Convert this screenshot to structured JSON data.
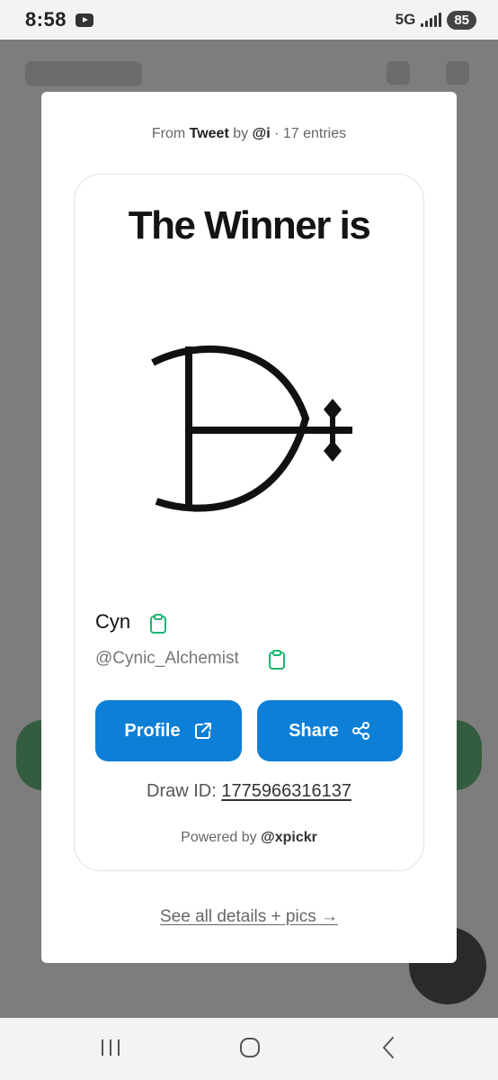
{
  "status_bar": {
    "time": "8:58",
    "network": "5G",
    "battery": "85"
  },
  "modal": {
    "source": {
      "prefix": "From",
      "platform": "Tweet",
      "by_label": "by",
      "author": "@i",
      "entries": "· 17 entries"
    },
    "title": "The Winner is",
    "winner": {
      "name": "Cyn",
      "handle": "@Cynic_Alchemist"
    },
    "buttons": {
      "profile_label": "Profile",
      "share_label": "Share"
    },
    "draw": {
      "label": "Draw ID:",
      "value": "1775966316137"
    },
    "powered": {
      "label": "Powered by",
      "brand": "@xpickr"
    },
    "details_link": "See all details + pics →"
  },
  "icons": {
    "copy": "clipboard-icon",
    "profile": "external-link-icon",
    "share": "share-icon",
    "avatar": "alchemical-symbol"
  },
  "colors": {
    "primary_button": "#0d7fd6",
    "copy_icon": "#1fb574"
  }
}
